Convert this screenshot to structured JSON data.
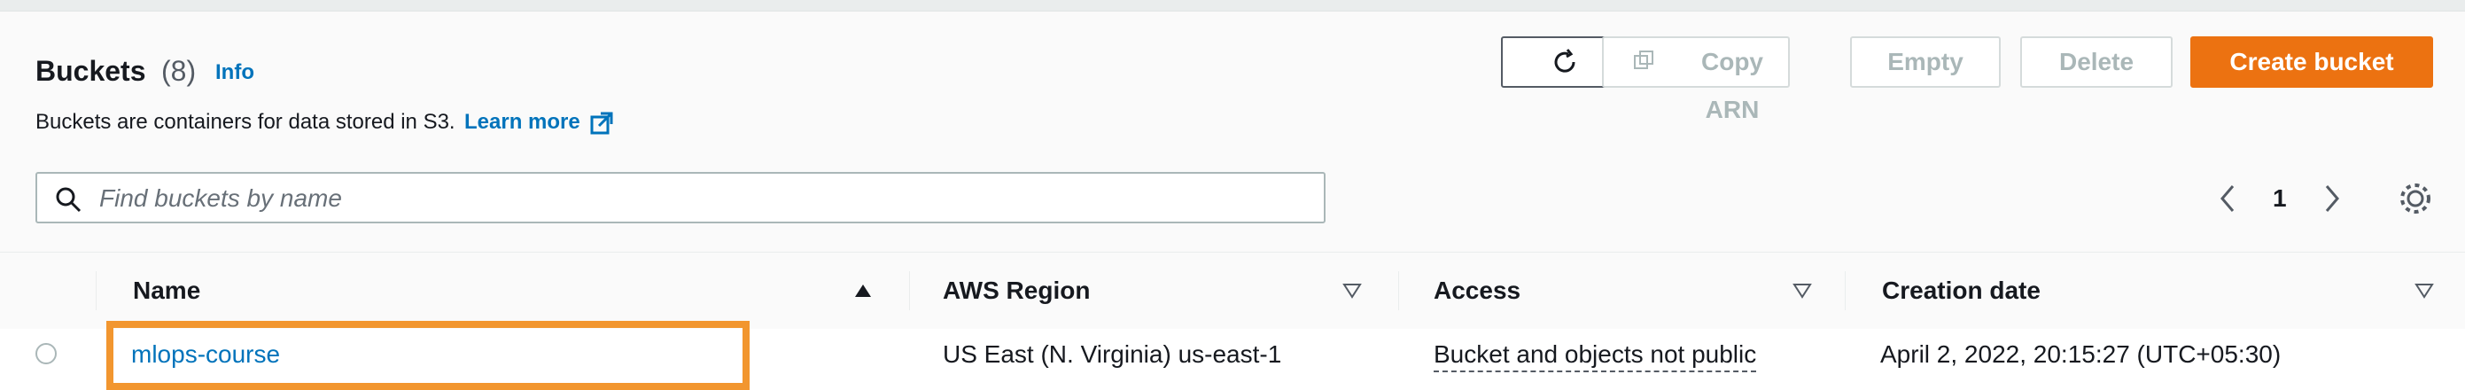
{
  "header": {
    "title": "Buckets",
    "count": "(8)",
    "info_label": "Info",
    "description": "Buckets are containers for data stored in S3.",
    "learn_more": "Learn more"
  },
  "toolbar": {
    "refresh_icon": "refresh-icon",
    "copy_arn_label": "Copy ARN",
    "copy_icon": "copy-icon",
    "empty_label": "Empty",
    "delete_label": "Delete",
    "create_label": "Create bucket"
  },
  "search": {
    "placeholder": "Find buckets by name",
    "value": ""
  },
  "pagination": {
    "current_page": "1"
  },
  "table": {
    "columns": [
      "Name",
      "AWS Region",
      "Access",
      "Creation date"
    ],
    "rows": [
      {
        "name": "mlops-course",
        "region": "US East (N. Virginia) us-east-1",
        "access": "Bucket and objects not public",
        "created": "April 2, 2022, 20:15:27 (UTC+05:30)"
      }
    ]
  },
  "colors": {
    "primary": "#ec7211",
    "link": "#0073bb",
    "highlight": "#f2962f"
  }
}
